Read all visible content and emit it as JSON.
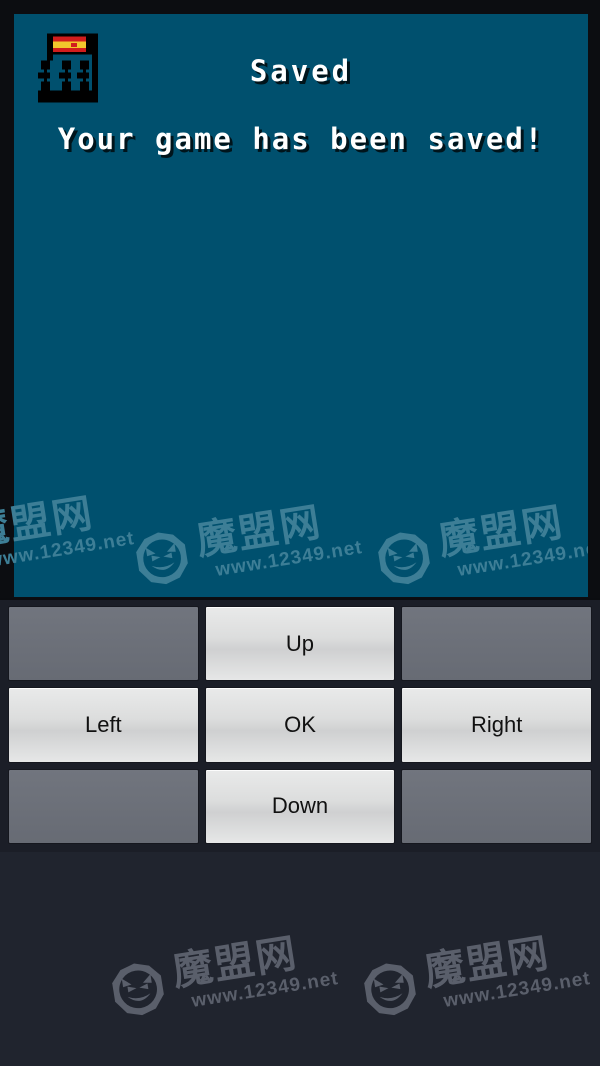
{
  "screen": {
    "background_color": "#00506e",
    "frame_color": "#0c0d11",
    "icon": {
      "name": "pixel-flag-ruins-icon",
      "flag_colors": [
        "#d11d1d",
        "#f2c72c",
        "#d11d1d"
      ],
      "structure_color": "#000000"
    },
    "dialog": {
      "title": "Saved",
      "message": "Your game has been saved!"
    }
  },
  "controls": {
    "background_color": "#1b1e27",
    "active_button_color": "#dcdddd",
    "blank_button_color": "#6b6f78",
    "rows": [
      [
        {
          "name": "blank-top-left",
          "label": "",
          "state": "blank"
        },
        {
          "name": "up",
          "label": "Up",
          "state": "active"
        },
        {
          "name": "blank-top-right",
          "label": "",
          "state": "blank"
        }
      ],
      [
        {
          "name": "left",
          "label": "Left",
          "state": "active"
        },
        {
          "name": "ok",
          "label": "OK",
          "state": "active"
        },
        {
          "name": "right",
          "label": "Right",
          "state": "active"
        }
      ],
      [
        {
          "name": "blank-bottom-left",
          "label": "",
          "state": "blank"
        },
        {
          "name": "down",
          "label": "Down",
          "state": "active"
        },
        {
          "name": "blank-bottom-right",
          "label": "",
          "state": "blank"
        }
      ]
    ]
  },
  "watermarks": {
    "cn_text": "魔盟网",
    "url_text": "www.12349.net",
    "logo_name": "imp-face-logo",
    "color_on_screen": "#3d7e96",
    "color_on_dark": "#5a5f6b"
  }
}
